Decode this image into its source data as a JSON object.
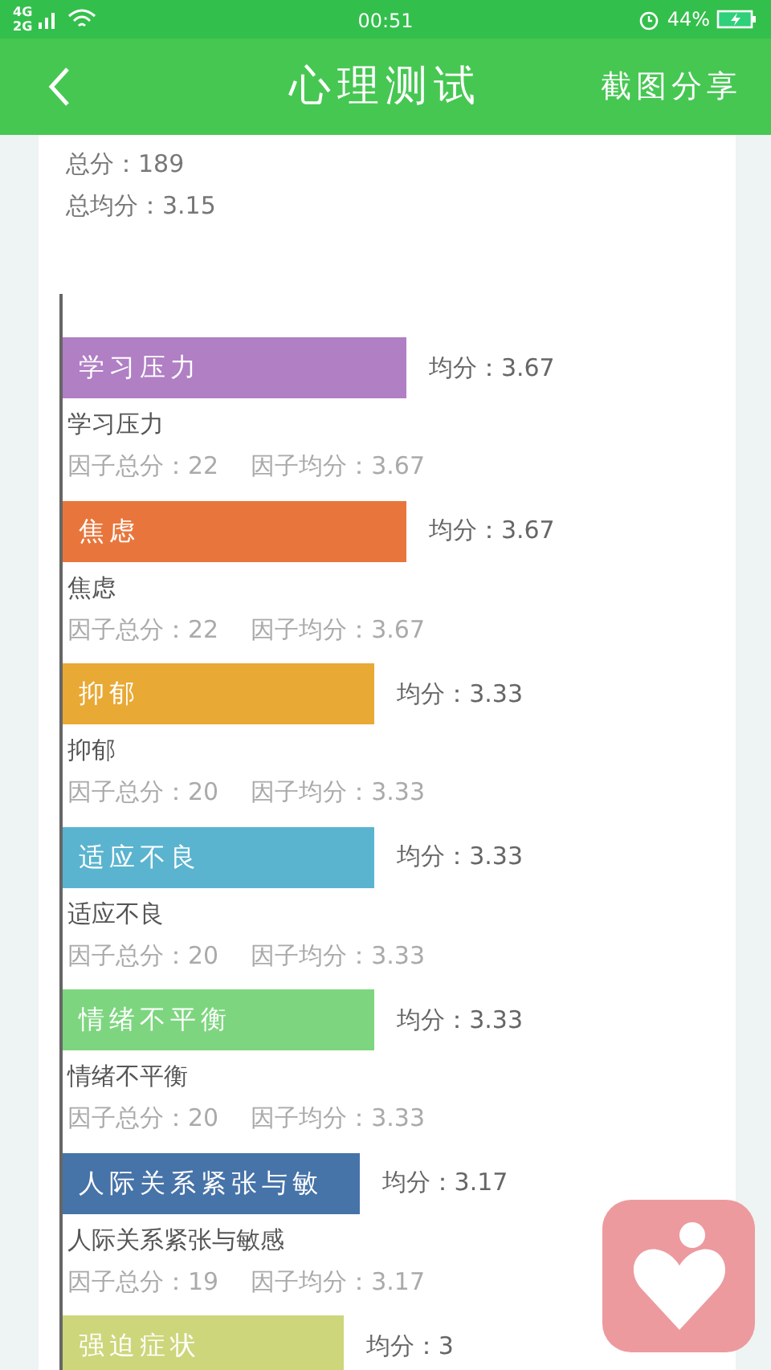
{
  "status_bar": {
    "network": [
      "4G",
      "2G"
    ],
    "time": "00:51",
    "battery": "44%",
    "charging": true
  },
  "header": {
    "title": "心理测试",
    "action": "截图分享"
  },
  "summary": [
    "总分：189",
    "总均分：3.15"
  ],
  "factors": [
    {
      "label": "学习压力",
      "average": "均分：3.67",
      "color": "#b07fc4",
      "name": "学习压力",
      "total": "因子总分：22",
      "factor_average": "因子均分：3.67"
    },
    {
      "label": "焦虑",
      "average": "均分：3.67",
      "color": "#e8763c",
      "name": "焦虑",
      "total": "因子总分：22",
      "factor_average": "因子均分：3.67"
    },
    {
      "label": "抑郁",
      "average": "均分：3.33",
      "color": "#e8a935",
      "name": "抑郁",
      "total": "因子总分：20",
      "factor_average": "因子均分：3.33"
    },
    {
      "label": "适应不良",
      "average": "均分：3.33",
      "color": "#5ab4cf",
      "name": "适应不良",
      "total": "因子总分：20",
      "factor_average": "因子均分：3.33"
    },
    {
      "label": "情绪不平衡",
      "average": "均分：3.33",
      "color": "#7dd67f",
      "name": "情绪不平衡",
      "total": "因子总分：20",
      "factor_average": "因子均分：3.33"
    },
    {
      "label": "人际关系紧张与敏",
      "average": "均分：3.17",
      "color": "#4673a8",
      "name": "人际关系紧张与敏感",
      "total": "因子总分：19",
      "factor_average": "因子均分：3.17"
    },
    {
      "label": "强迫症状",
      "average": "均分：3",
      "color": "#cdd67a"
    }
  ]
}
